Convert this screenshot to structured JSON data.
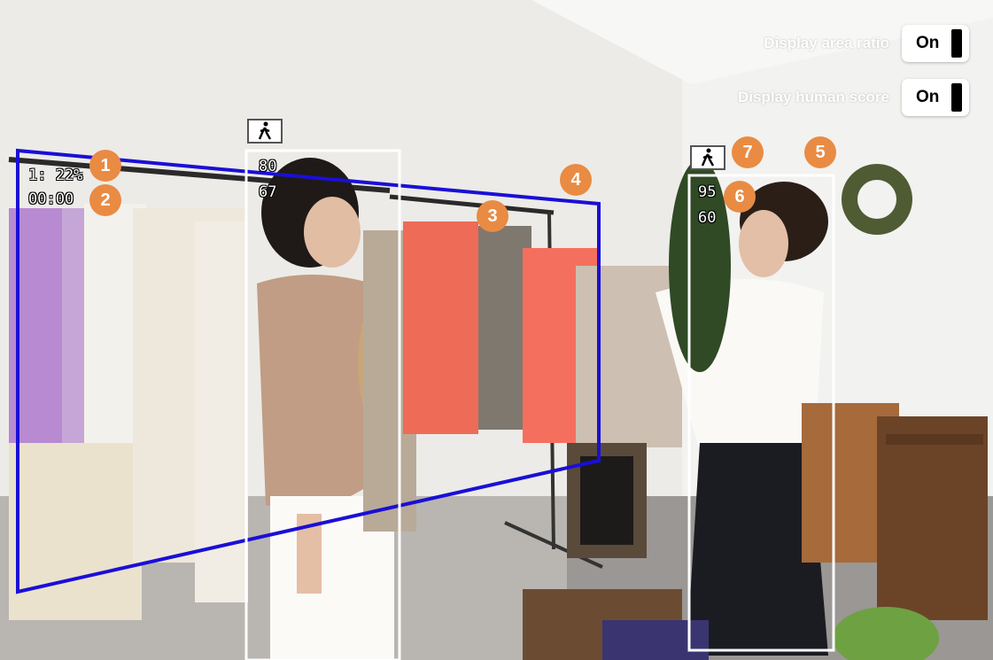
{
  "controls": {
    "area_ratio": {
      "label": "Display area ratio",
      "value": "On"
    },
    "human_score": {
      "label": "Display human score",
      "value": "On"
    }
  },
  "overlay": {
    "area_ratio_text": "1: 22%",
    "timer_text": "00:00",
    "person1": {
      "score_a": "80",
      "score_b": "67"
    },
    "person2": {
      "score_a": "95",
      "score_b": "60"
    }
  },
  "callouts": [
    "1",
    "2",
    "3",
    "4",
    "5",
    "6",
    "7"
  ],
  "icons": {
    "person": "walking-person-icon"
  },
  "colors": {
    "badge": "#e98b43",
    "roi": "#1a0fd6",
    "bbox": "#ffffff"
  }
}
